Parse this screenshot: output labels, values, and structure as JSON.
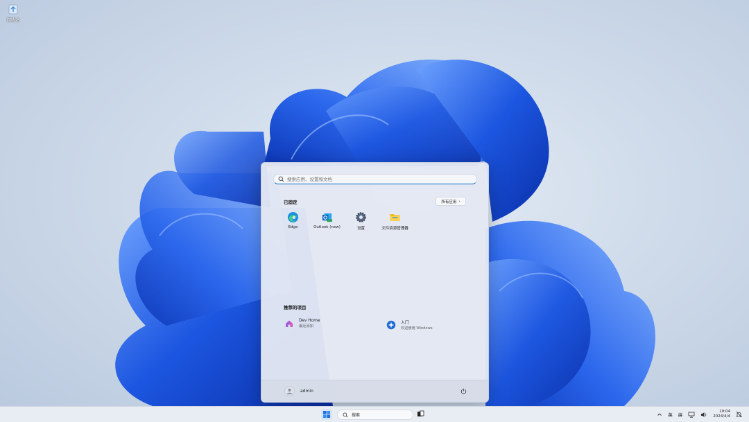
{
  "desktop": {
    "recycle_bin_label": "回收站"
  },
  "start_menu": {
    "search_placeholder": "搜索应用、设置和文档",
    "pinned_title": "已固定",
    "all_apps_label": "所有应用",
    "pinned_apps": [
      {
        "label": "Edge",
        "icon": "edge-icon"
      },
      {
        "label": "Outlook (new)",
        "icon": "outlook-icon"
      },
      {
        "label": "设置",
        "icon": "settings-gear-icon"
      },
      {
        "label": "文件资源管理器",
        "icon": "folder-icon"
      }
    ],
    "recommended_title": "推荐的项目",
    "recommended": [
      {
        "title": "Dev Home",
        "subtitle": "最近添加",
        "icon": "dev-home-icon"
      },
      {
        "title": "入门",
        "subtitle": "欢迎使用 Windows",
        "icon": "get-started-icon"
      }
    ],
    "user_name": "admin"
  },
  "taskbar": {
    "search_label": "搜索",
    "tray_lang1": "英",
    "tray_lang2": "拼",
    "clock_time": "19:04",
    "clock_date": "2024/4/4"
  },
  "colors": {
    "accent": "#0067c0",
    "bloom_blue": "#1f5fe8"
  }
}
